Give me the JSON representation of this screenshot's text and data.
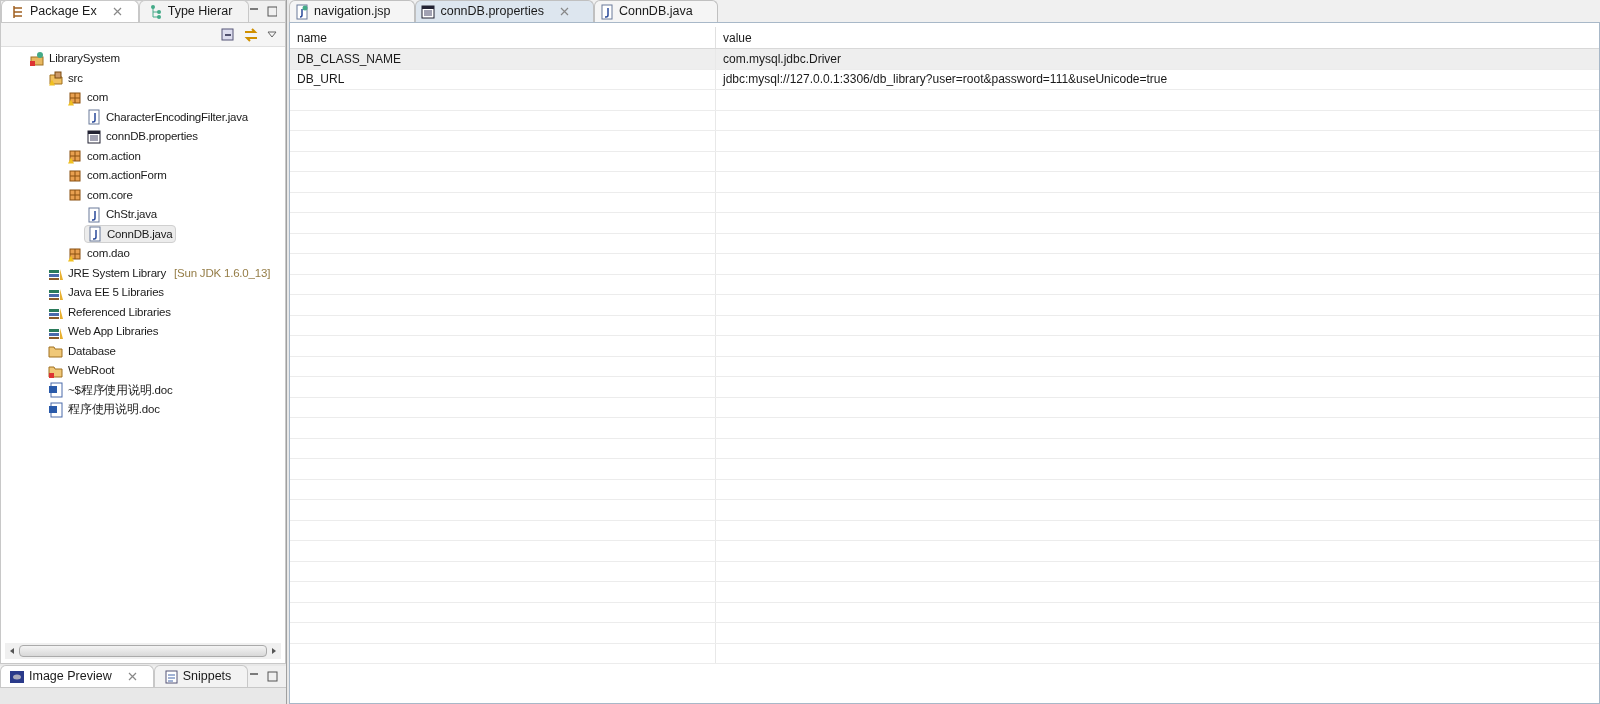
{
  "package_explorer": {
    "tabs": [
      {
        "label": "Package Ex",
        "kind": "package",
        "selected": true
      },
      {
        "label": "Type Hierar",
        "kind": "hierarchy",
        "selected": false
      }
    ],
    "tree": [
      {
        "label": "LibrarySystem",
        "kind": "project",
        "warning": false,
        "selected": false,
        "children": [
          {
            "label": "src",
            "kind": "source",
            "warning": true,
            "selected": false,
            "children": [
              {
                "label": "com",
                "kind": "package",
                "warning": true,
                "selected": false,
                "children": [
                  {
                    "label": "CharacterEncodingFilter.java",
                    "kind": "java",
                    "warning": false,
                    "selected": false
                  },
                  {
                    "label": "connDB.properties",
                    "kind": "properties",
                    "warning": false,
                    "selected": false
                  }
                ]
              },
              {
                "label": "com.action",
                "kind": "package",
                "warning": true,
                "selected": false
              },
              {
                "label": "com.actionForm",
                "kind": "package",
                "warning": false,
                "selected": false
              },
              {
                "label": "com.core",
                "kind": "package",
                "warning": false,
                "selected": false,
                "children": [
                  {
                    "label": "ChStr.java",
                    "kind": "java",
                    "warning": false,
                    "selected": false
                  },
                  {
                    "label": "ConnDB.java",
                    "kind": "java",
                    "warning": false,
                    "selected": true
                  }
                ]
              },
              {
                "label": "com.dao",
                "kind": "package",
                "warning": true,
                "selected": false
              }
            ]
          },
          {
            "label": "JRE System Library",
            "decoration": "[Sun JDK 1.6.0_13]",
            "kind": "library",
            "warning": false,
            "selected": false
          },
          {
            "label": "Java EE 5 Libraries",
            "kind": "library",
            "warning": false,
            "selected": false
          },
          {
            "label": "Referenced Libraries",
            "kind": "library",
            "warning": false,
            "selected": false
          },
          {
            "label": "Web App Libraries",
            "kind": "library",
            "warning": false,
            "selected": false
          },
          {
            "label": "Database",
            "kind": "folder",
            "warning": false,
            "selected": false
          },
          {
            "label": "WebRoot",
            "kind": "webroot",
            "warning": false,
            "selected": false
          },
          {
            "label": "~$程序使用说明.doc",
            "kind": "doc",
            "warning": false,
            "selected": false
          },
          {
            "label": "程序使用说明.doc",
            "kind": "doc",
            "warning": false,
            "selected": false
          }
        ]
      }
    ]
  },
  "bottom_view": {
    "tabs": [
      {
        "label": "Image Preview",
        "kind": "image",
        "selected": true
      },
      {
        "label": "Snippets",
        "kind": "snippets",
        "selected": false
      }
    ]
  },
  "editor": {
    "tabs": [
      {
        "label": "navigation.jsp",
        "kind": "jsp",
        "selected": false
      },
      {
        "label": "connDB.properties",
        "kind": "properties",
        "selected": true
      },
      {
        "label": "ConnDB.java",
        "kind": "java",
        "selected": false
      }
    ],
    "table": {
      "columns": [
        "name",
        "value"
      ],
      "rows": [
        {
          "name": "DB_CLASS_NAME",
          "value": "com.mysql.jdbc.Driver",
          "selected": true
        },
        {
          "name": "DB_URL",
          "value": "jdbc:mysql://127.0.0.1:3306/db_library?user=root&password=111&useUnicode=true",
          "selected": false
        }
      ]
    }
  }
}
